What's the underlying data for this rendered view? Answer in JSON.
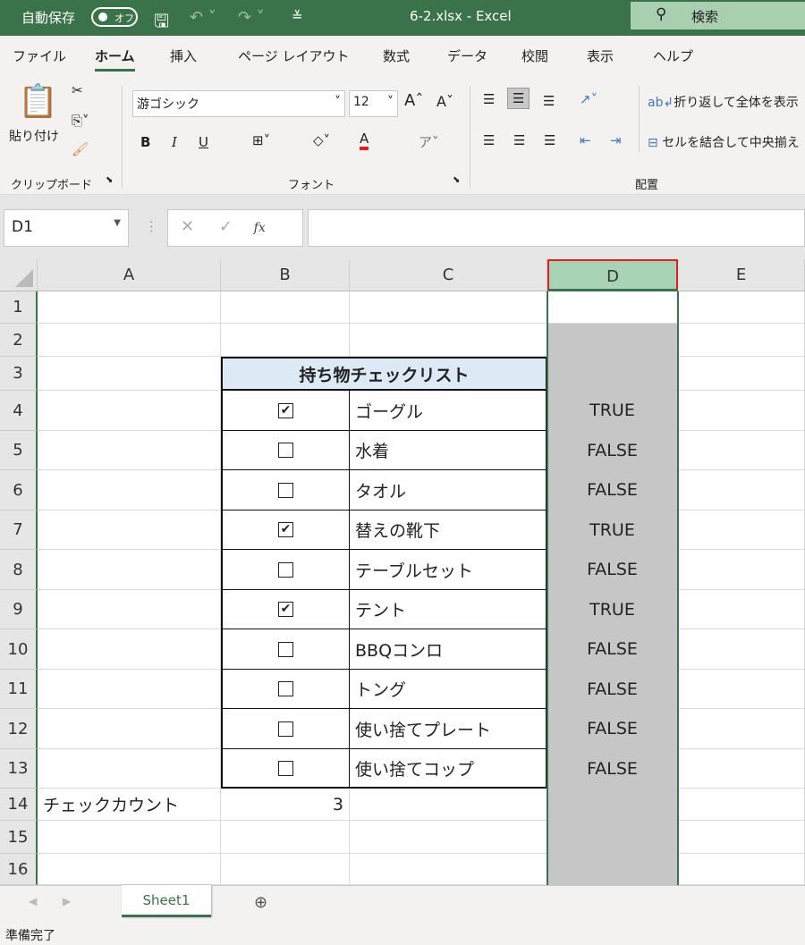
{
  "titlebar": {
    "autosave": "自動保存",
    "toggle": "オフ",
    "title": "6-2.xlsx  -  Excel",
    "search": "検索"
  },
  "tabs": [
    "ファイル",
    "ホーム",
    "挿入",
    "ページ レイアウト",
    "数式",
    "データ",
    "校閲",
    "表示",
    "ヘルプ"
  ],
  "ribbon": {
    "paste": "貼り付け",
    "font_name": "游ゴシック",
    "font_size": "12",
    "bold": "B",
    "italic": "I",
    "underline": "U",
    "wrap": "折り返して全体を表示",
    "merge": "セルを結合して中央揃え",
    "groups": {
      "clipboard": "クリップボード",
      "font": "フォント",
      "alignment": "配置"
    }
  },
  "formula_bar": {
    "name_box": "D1",
    "fx": "fx",
    "value": ""
  },
  "columns": [
    "A",
    "B",
    "C",
    "D",
    "E"
  ],
  "rows": [
    "1",
    "2",
    "3",
    "4",
    "5",
    "6",
    "7",
    "8",
    "9",
    "10",
    "11",
    "12",
    "13",
    "14",
    "15",
    "16"
  ],
  "table": {
    "title": "持ち物チェックリスト",
    "items": [
      {
        "checked": true,
        "name": "ゴーグル",
        "value": "TRUE"
      },
      {
        "checked": false,
        "name": "水着",
        "value": "FALSE"
      },
      {
        "checked": false,
        "name": "タオル",
        "value": "FALSE"
      },
      {
        "checked": true,
        "name": "替えの靴下",
        "value": "TRUE"
      },
      {
        "checked": false,
        "name": "テーブルセット",
        "value": "FALSE"
      },
      {
        "checked": true,
        "name": "テント",
        "value": "TRUE"
      },
      {
        "checked": false,
        "name": "BBQコンロ",
        "value": "FALSE"
      },
      {
        "checked": false,
        "name": "トング",
        "value": "FALSE"
      },
      {
        "checked": false,
        "name": "使い捨てプレート",
        "value": "FALSE"
      },
      {
        "checked": false,
        "name": "使い捨てコップ",
        "value": "FALSE"
      }
    ]
  },
  "count": {
    "label": "チェックカウント",
    "value": "3"
  },
  "sheet_tab": "Sheet1",
  "status": "準備完了"
}
